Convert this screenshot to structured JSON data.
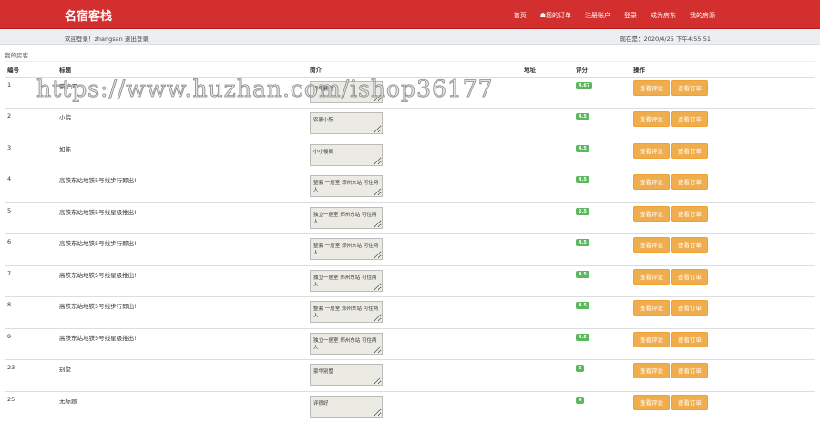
{
  "header": {
    "logo": "名宿客栈",
    "nav": [
      "首页",
      "您的订单",
      "注册账户",
      "登录",
      "成为房东",
      "我的房源"
    ]
  },
  "subbar": {
    "welcome": "欢迎登录！zhangsan 退出登录",
    "now": "现在是：2020/4/25 下午4:55:51"
  },
  "section_title": "我的房客",
  "table": {
    "headers": [
      "编号",
      "标题",
      "简介",
      "地址",
      "评分",
      "操作"
    ],
    "rows": [
      {
        "id": "1",
        "title": "豪华间",
        "intro": "豪华套房",
        "address": "",
        "rating": "4.67"
      },
      {
        "id": "2",
        "title": "小院",
        "intro": "农家小院",
        "address": "",
        "rating": "4.5"
      },
      {
        "id": "3",
        "title": "如陈",
        "intro": "小小楼阁",
        "address": "",
        "rating": "4.5"
      },
      {
        "id": "4",
        "title": "高铁东站地铁5号线步行即出!",
        "intro": "整套 一居室 郑州东站 可住两人",
        "address": "",
        "rating": "4.5"
      },
      {
        "id": "5",
        "title": "高铁东站地铁5号线星级推出!",
        "intro": "独立一居室 郑州东站 可住两人",
        "address": "",
        "rating": "2.5"
      },
      {
        "id": "6",
        "title": "高铁东站地铁5号线步行即出!",
        "intro": "整套 一居室 郑州东站 可住两人",
        "address": "",
        "rating": "4.5"
      },
      {
        "id": "7",
        "title": "高铁东站地铁5号线星级推出!",
        "intro": "独立一居室 郑州东站 可住两人",
        "address": "",
        "rating": "4.5"
      },
      {
        "id": "8",
        "title": "高铁东站地铁5号线步行即出!",
        "intro": "整套 一居室 郑州东站 可住两人",
        "address": "",
        "rating": "4.5"
      },
      {
        "id": "9",
        "title": "高铁东站地铁5号线星级推出!",
        "intro": "独立一居室 郑州东站 可住两人",
        "address": "",
        "rating": "4.5"
      },
      {
        "id": "23",
        "title": "别墅",
        "intro": "豪华别墅",
        "address": "",
        "rating": "5"
      },
      {
        "id": "25",
        "title": "无标题",
        "intro": "评很好",
        "address": "",
        "rating": "4"
      }
    ],
    "btn_comments": "查看评论",
    "btn_orders": "查看订单"
  },
  "watermark": "https://www.huzhan.com/ishop36177"
}
